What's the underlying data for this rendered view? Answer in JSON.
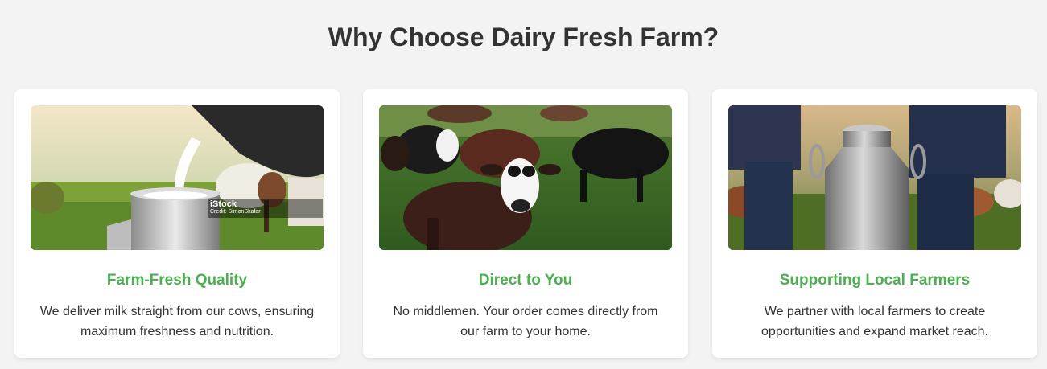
{
  "section": {
    "title": "Why Choose Dairy Fresh Farm?"
  },
  "cards": [
    {
      "title": "Farm-Fresh Quality",
      "description": "We deliver milk straight from our cows, ensuring maximum freshness and nutrition.",
      "image_watermark": "iStock",
      "image_credit": "Credit: SimonSkafar"
    },
    {
      "title": "Direct to You",
      "description": "No middlemen. Your order comes directly from our farm to your home."
    },
    {
      "title": "Supporting Local Farmers",
      "description": "We partner with local farmers to create opportunities and expand market reach."
    }
  ],
  "colors": {
    "accent": "#4caf50",
    "background": "#f3f3f3",
    "card": "#ffffff",
    "text": "#333333"
  }
}
